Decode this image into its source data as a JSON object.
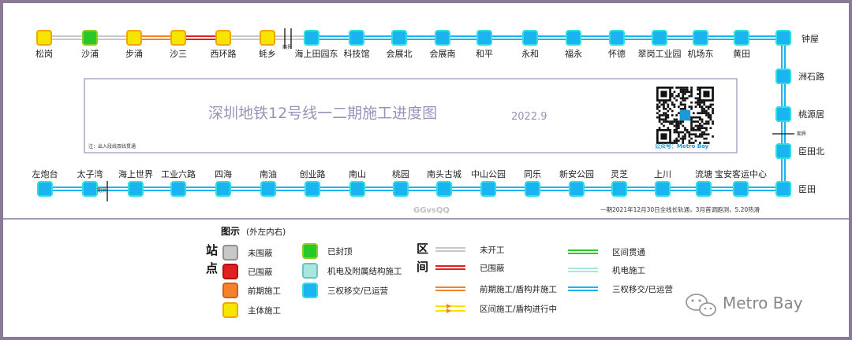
{
  "title": "深圳地铁12号线一二期施工进度图",
  "date": "2022.9",
  "note": "注：出入段线双线贯通",
  "watermark": "GGvsQQ",
  "qr_caption": "公众号：Metro Bay",
  "footnote": "一期2021年12月30日全线长轨通，3月首调跑测，5.20热滑",
  "brand": "Metro Bay",
  "colors": {
    "frame": "#8a7a9a",
    "not_started": "#c8c8c8",
    "enclosed": "#e02020",
    "pre_construction": "#f5822a",
    "main_construction": "#f7e400",
    "capped": "#28c828",
    "mep": "#a8e6e0",
    "handover": "#1ab4f0",
    "cyan_border": "#30e0e0"
  },
  "top_row": [
    {
      "name": "松岗",
      "status": "main"
    },
    {
      "name": "沙浦",
      "status": "capped"
    },
    {
      "name": "步涌",
      "status": "main"
    },
    {
      "name": "沙三",
      "status": "main"
    },
    {
      "name": "西环路",
      "status": "main"
    },
    {
      "name": "蚝乡",
      "status": "main"
    },
    {
      "name": "海上田园东",
      "status": "handover"
    },
    {
      "name": "科技馆",
      "status": "handover"
    },
    {
      "name": "会展北",
      "status": "handover"
    },
    {
      "name": "会展南",
      "status": "handover"
    },
    {
      "name": "和平",
      "status": "handover"
    },
    {
      "name": "永和",
      "status": "handover"
    },
    {
      "name": "福永",
      "status": "handover"
    },
    {
      "name": "怀德",
      "status": "handover"
    },
    {
      "name": "翠岗工业园",
      "status": "handover"
    },
    {
      "name": "机场东",
      "status": "handover"
    },
    {
      "name": "黄田",
      "status": "handover"
    },
    {
      "name": "钟屋",
      "status": "handover"
    }
  ],
  "top_segments": [
    "not_started",
    "not_started",
    "pre_construction",
    "enclosed",
    "not_started",
    "not_started",
    "handover",
    "handover",
    "handover",
    "handover",
    "handover",
    "handover",
    "handover",
    "handover",
    "handover",
    "handover",
    "handover"
  ],
  "right_col": [
    {
      "name": "洲石路",
      "status": "handover"
    },
    {
      "name": "桃源居",
      "status": "handover"
    },
    {
      "name": "臣田北",
      "status": "handover"
    },
    {
      "name": "臣田",
      "status": "handover"
    }
  ],
  "bottom_row": [
    {
      "name": "左炮台",
      "status": "handover"
    },
    {
      "name": "太子湾",
      "status": "handover"
    },
    {
      "name": "海上世界",
      "status": "handover"
    },
    {
      "name": "工业六路",
      "status": "handover"
    },
    {
      "name": "四海",
      "status": "handover"
    },
    {
      "name": "南油",
      "status": "handover"
    },
    {
      "name": "创业路",
      "status": "handover"
    },
    {
      "name": "南山",
      "status": "handover"
    },
    {
      "name": "桃园",
      "status": "handover"
    },
    {
      "name": "南头古城",
      "status": "handover"
    },
    {
      "name": "中山公园",
      "status": "handover"
    },
    {
      "name": "同乐",
      "status": "handover"
    },
    {
      "name": "新安公园",
      "status": "handover"
    },
    {
      "name": "灵芝",
      "status": "handover"
    },
    {
      "name": "上川",
      "status": "handover"
    },
    {
      "name": "流塘",
      "status": "handover"
    },
    {
      "name": "宝安客运中心",
      "status": "handover"
    }
  ],
  "tiny_labels": {
    "top_break": "期界",
    "right_break": "期界",
    "bottom_break": "期界"
  },
  "legend": {
    "title": "图示",
    "subtitle": "(外左内右)",
    "station_heading": [
      "站",
      "点"
    ],
    "section_heading": [
      "区",
      "间"
    ],
    "station_items": [
      {
        "label": "未围蔽",
        "status": "not_started"
      },
      {
        "label": "已围蔽",
        "status": "enclosed"
      },
      {
        "label": "前期施工",
        "status": "pre_construction"
      },
      {
        "label": "主体施工",
        "status": "main"
      },
      {
        "label": "已封顶",
        "status": "capped"
      },
      {
        "label": "机电及附属结构施工",
        "status": "mep"
      },
      {
        "label": "三权移交/已运营",
        "status": "handover"
      }
    ],
    "section_items": [
      {
        "label": "未开工",
        "status": "not_started"
      },
      {
        "label": "已围蔽",
        "status": "enclosed"
      },
      {
        "label": "前期施工/盾构井施工",
        "status": "pre_construction"
      },
      {
        "label": "区间施工/盾构进行中",
        "status": "tunneling"
      },
      {
        "label": "区间贯通",
        "status": "through"
      },
      {
        "label": "机电施工",
        "status": "mep"
      },
      {
        "label": "三权移交/已运营",
        "status": "handover"
      }
    ]
  }
}
